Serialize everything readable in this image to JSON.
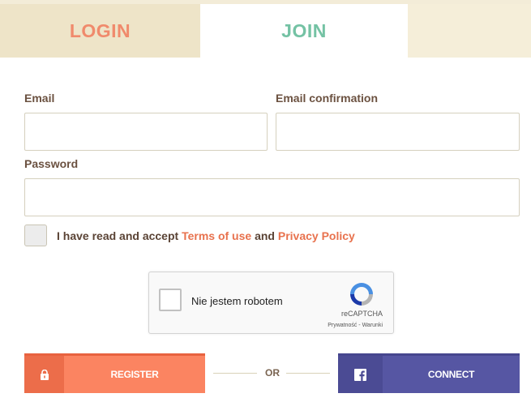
{
  "tabs": {
    "login": "LOGIN",
    "join": "JOIN"
  },
  "form": {
    "email_label": "Email",
    "email_value": "",
    "email_confirm_label": "Email confirmation",
    "email_confirm_value": "",
    "password_label": "Password",
    "password_value": "",
    "accept_prefix": "I have read and accept ",
    "terms_link": "Terms of use",
    "accept_and": " and ",
    "privacy_link": "Privacy Policy",
    "accept_checked": false
  },
  "captcha": {
    "label": "Nie jestem robotem",
    "brand": "reCAPTCHA",
    "terms": "Prywatność - Warunki"
  },
  "actions": {
    "register": "REGISTER",
    "or": "OR",
    "connect": "CONNECT",
    "register_icon": "lock-icon",
    "connect_icon": "facebook-icon"
  },
  "colors": {
    "login_tab": "#f08a6c",
    "join_tab": "#74c2a4",
    "register_button": "#fb8461",
    "connect_button": "#5656a3",
    "link": "#e8724e"
  }
}
